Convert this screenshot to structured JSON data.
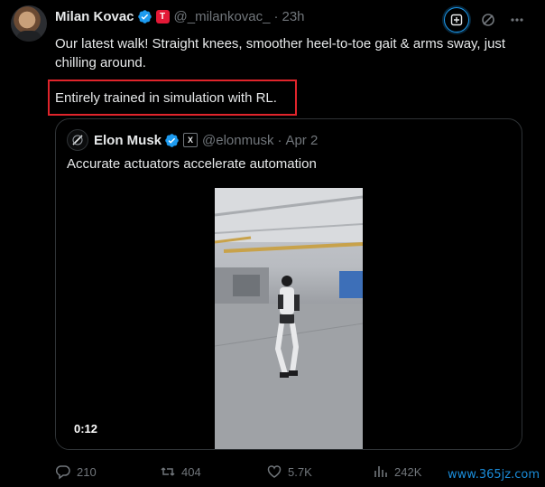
{
  "author": {
    "name": "Milan Kovac",
    "handle": "@_milankovac_",
    "time": "23h",
    "affiliation_badge": "T",
    "verified_color": "#1d9bf0",
    "affiliation_color": "#e31937"
  },
  "tweet": {
    "line1": "Our latest walk! Straight knees, smoother heel-to-toe gait & arms sway, just chilling around.",
    "line2": "Entirely trained in simulation with RL.",
    "highlight_color": "#e0242b"
  },
  "quote": {
    "author_name": "Elon Musk",
    "author_handle": "@elonmusk",
    "badge": "X",
    "date": "Apr 2",
    "text": "Accurate actuators accelerate automation",
    "video_duration": "0:12"
  },
  "actions": {
    "replies": "210",
    "reposts": "404",
    "likes": "5.7K",
    "views": "242K"
  },
  "icons": {
    "top": [
      "grok-icon",
      "no-sign-icon",
      "more-icon"
    ],
    "bottom": [
      "reply-icon",
      "repost-icon",
      "like-icon",
      "views-icon"
    ]
  },
  "watermark": "www.365jz.com"
}
